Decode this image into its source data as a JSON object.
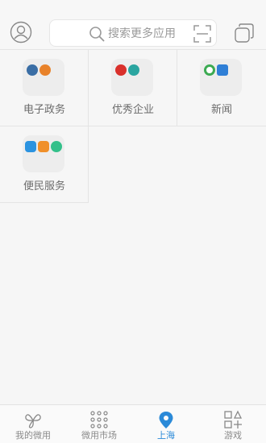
{
  "header": {
    "search_placeholder": "搜索更多应用",
    "icons": [
      "avatar-icon",
      "search-icon",
      "scan-icon",
      "cards-icon"
    ]
  },
  "categories": [
    {
      "label": "电子政务",
      "mini_icons": [
        {
          "name": "police-badge-icon",
          "color": "#3a6ea5"
        },
        {
          "name": "orange-seal-icon",
          "color": "#e8822a"
        }
      ]
    },
    {
      "label": "优秀企业",
      "mini_icons": [
        {
          "name": "red-logo-icon",
          "color": "#d9302b"
        },
        {
          "name": "teal-logo-icon",
          "color": "#2aa5a0"
        }
      ]
    },
    {
      "label": "新闻",
      "mini_icons": [
        {
          "name": "green-ring-icon",
          "color": "#3caa52"
        },
        {
          "name": "blue-news-icon",
          "color": "#2f7fd6"
        }
      ]
    },
    {
      "label": "便民服务",
      "mini_icons": [
        {
          "name": "blue-service-icon",
          "color": "#2b93e0"
        },
        {
          "name": "orange-person-icon",
          "color": "#f0902a"
        },
        {
          "name": "green-grid-icon",
          "color": "#33c08a"
        }
      ]
    }
  ],
  "tabs": [
    {
      "label": "我的微用",
      "icon": "leaves-icon"
    },
    {
      "label": "微用市场",
      "icon": "dots-grid-icon"
    },
    {
      "label": "上海",
      "icon": "location-pin-icon",
      "active": true
    },
    {
      "label": "游戏",
      "icon": "shapes-icon"
    }
  ],
  "colors": {
    "accent": "#2b8ad8",
    "text": "#6b6b6b",
    "background": "#f6f6f6"
  }
}
